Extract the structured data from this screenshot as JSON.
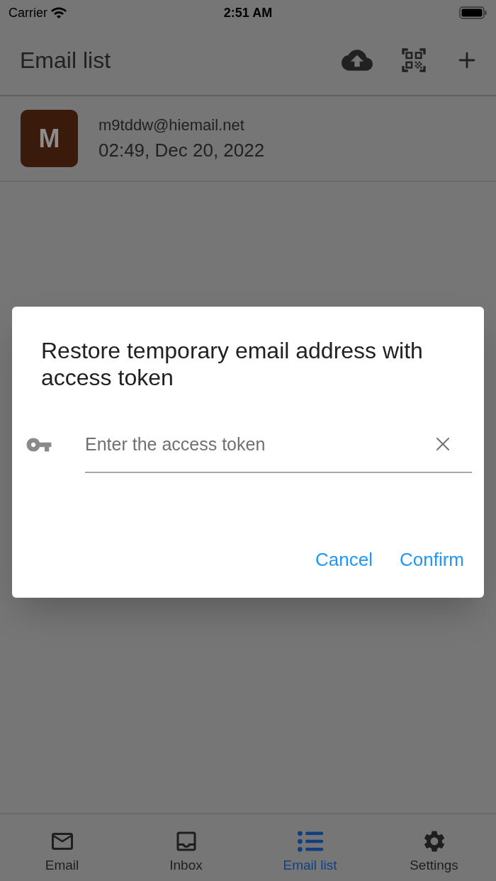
{
  "status_bar": {
    "carrier": "Carrier",
    "time": "2:51 AM"
  },
  "header": {
    "title": "Email list"
  },
  "emails": [
    {
      "initial": "M",
      "color": "#3a1a0b",
      "address": "m9tddw@hiemail.net",
      "created": "02:49, Dec 20, 2022"
    }
  ],
  "dialog": {
    "title": "Restore temporary email address with access token",
    "field": {
      "placeholder": "Enter the access token"
    },
    "buttons": [
      "Cancel",
      "Confirm"
    ]
  },
  "tabs": [
    {
      "label": "Email",
      "kind": "email",
      "selected": false
    },
    {
      "label": "Inbox",
      "kind": "inbox",
      "selected": false
    },
    {
      "label": "Email list",
      "kind": "list",
      "selected": true
    },
    {
      "label": "Settings",
      "kind": "settings",
      "selected": false
    }
  ]
}
